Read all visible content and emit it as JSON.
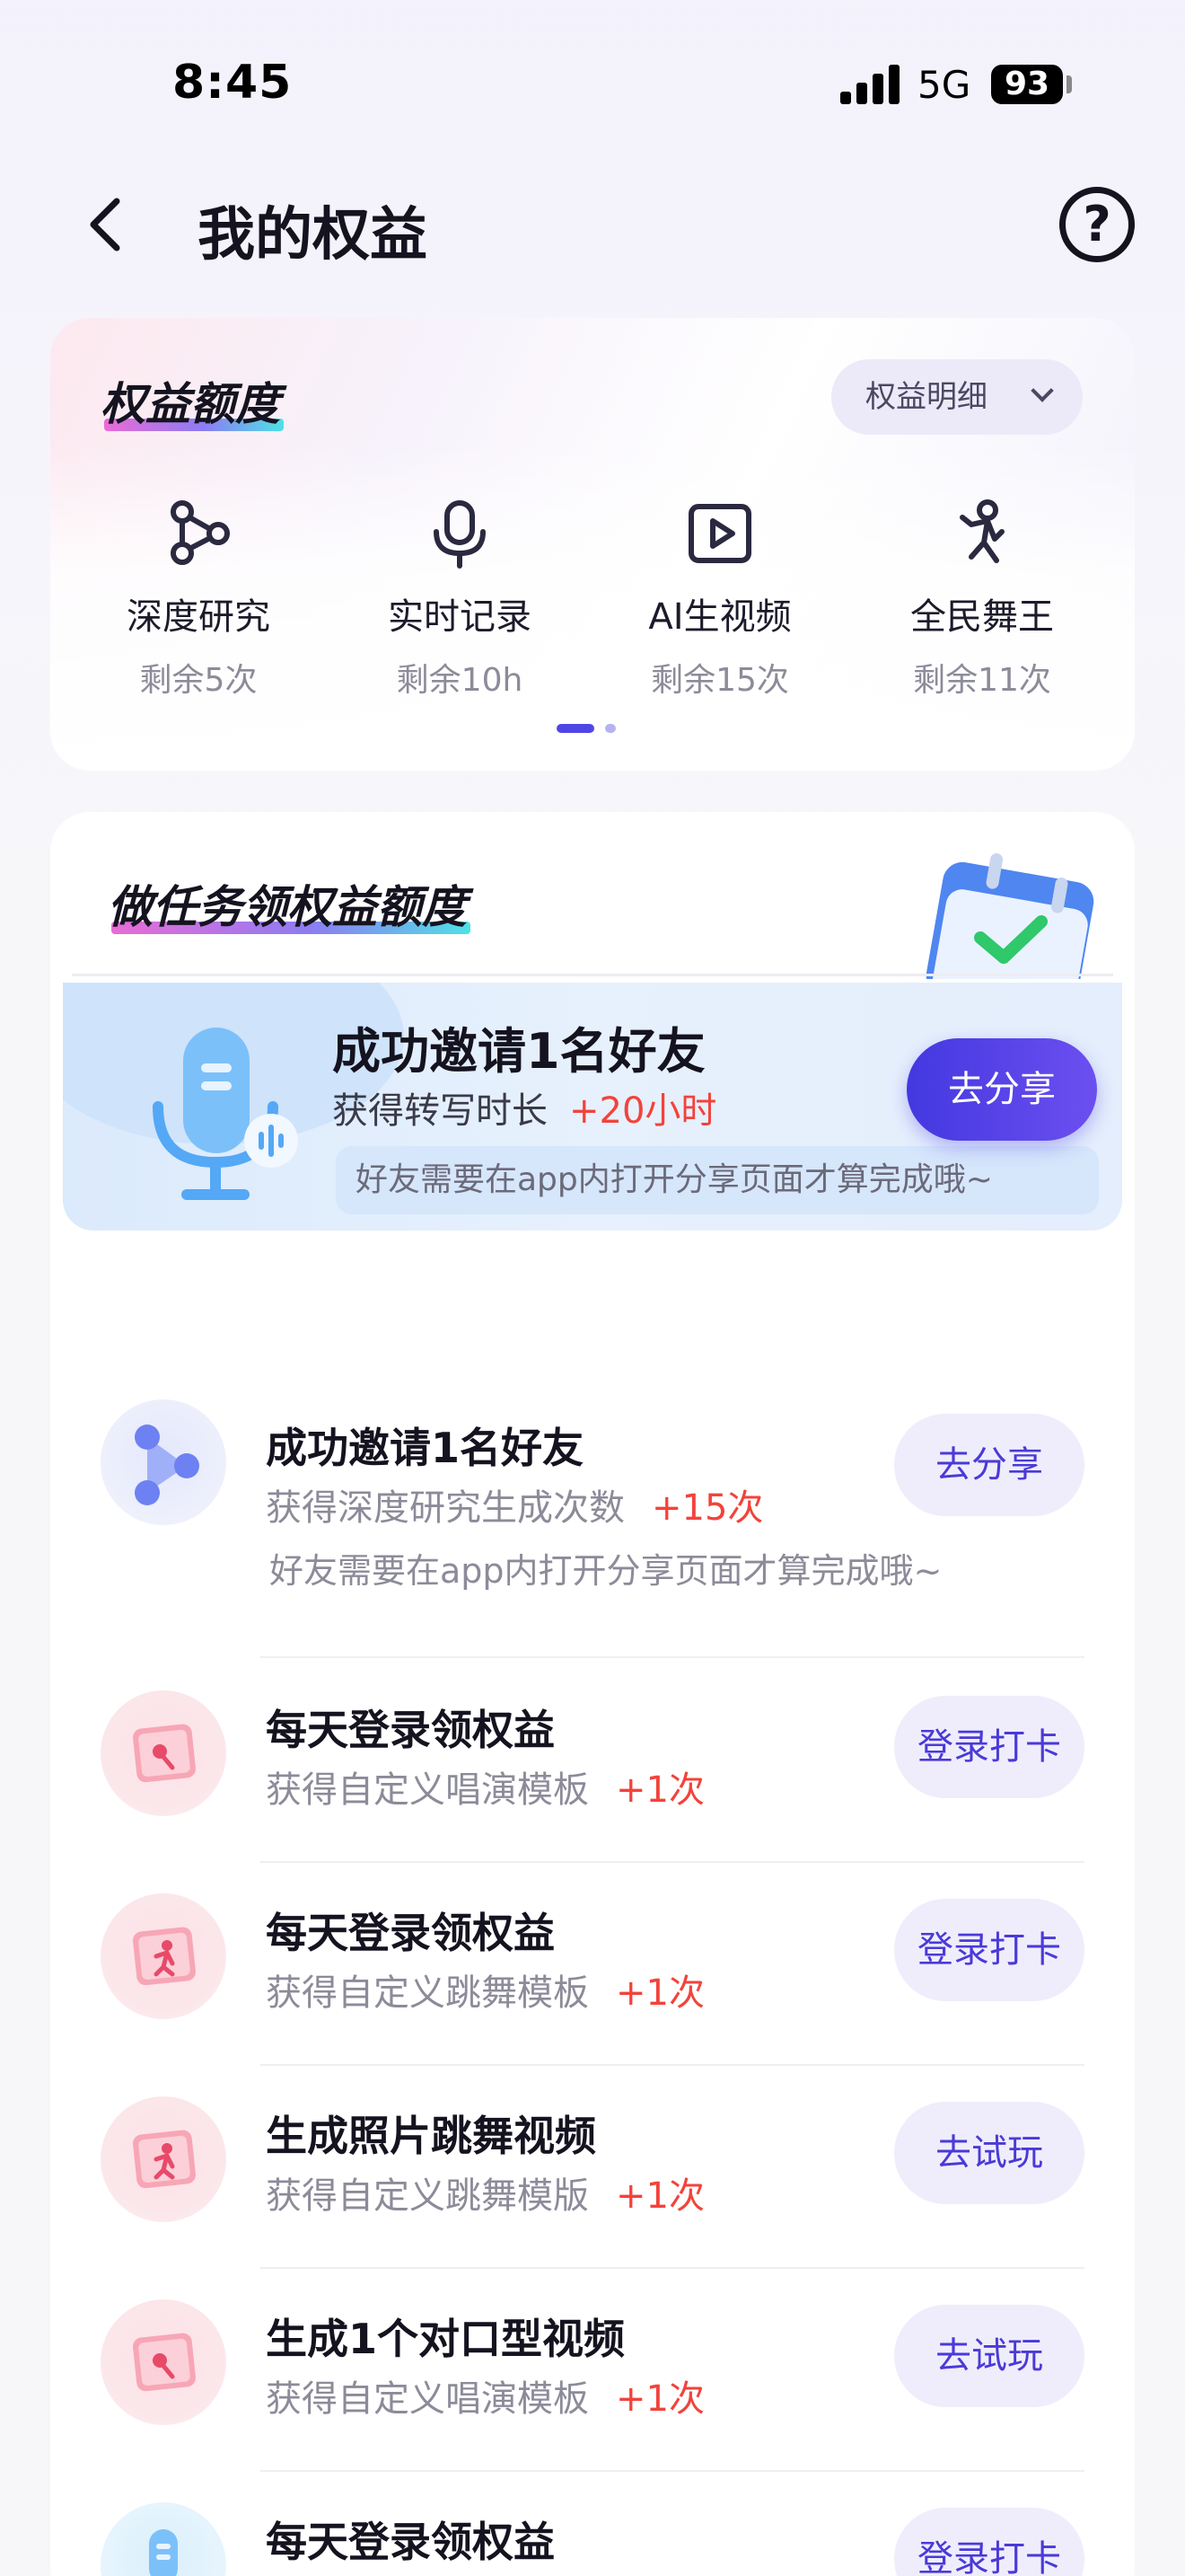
{
  "status_bar": {
    "time": "8:45",
    "network": "5G",
    "battery": "93"
  },
  "header": {
    "title": "我的权益",
    "help": "?"
  },
  "quota": {
    "title": "权益额度",
    "detail_label": "权益明细",
    "items": [
      {
        "name": "深度研究",
        "remaining": "剩余5次",
        "icon": "graph-icon"
      },
      {
        "name": "实时记录",
        "remaining": "剩余10h",
        "icon": "microphone-icon"
      },
      {
        "name": "AI生视频",
        "remaining": "剩余15次",
        "icon": "video-play-icon"
      },
      {
        "name": "全民舞王",
        "remaining": "剩余11次",
        "icon": "dancer-icon"
      }
    ],
    "page_dots": {
      "active": 1,
      "total": 2
    }
  },
  "tasks": {
    "title": "做任务领权益额度",
    "featured": {
      "title": "成功邀请1名好友",
      "reward_label": "获得转写时长",
      "reward_value": "+20小时",
      "note": "好友需要在app内打开分享页面才算完成哦~",
      "button": "去分享"
    },
    "items": [
      {
        "title": "成功邀请1名好友",
        "reward_label": "获得深度研究生成次数",
        "reward_value": "+15次",
        "note": "好友需要在app内打开分享页面才算完成哦~",
        "button": "去分享",
        "icon": "share-graph-icon"
      },
      {
        "title": "每天登录领权益",
        "reward_label": "获得自定义唱演模板",
        "reward_value": "+1次",
        "button": "登录打卡",
        "icon": "singing-template-icon"
      },
      {
        "title": "每天登录领权益",
        "reward_label": "获得自定义跳舞模板",
        "reward_value": "+1次",
        "button": "登录打卡",
        "icon": "dance-template-icon"
      },
      {
        "title": "生成照片跳舞视频",
        "reward_label": "获得自定义跳舞模版",
        "reward_value": "+1次",
        "button": "去试玩",
        "icon": "dance-template-icon"
      },
      {
        "title": "生成1个对口型视频",
        "reward_label": "获得自定义唱演模板",
        "reward_value": "+1次",
        "button": "去试玩",
        "icon": "singing-template-icon"
      },
      {
        "title": "每天登录领权益",
        "reward_label": "",
        "reward_value": "",
        "button": "登录打卡",
        "icon": "microphone-icon"
      }
    ]
  },
  "colors": {
    "accent": "#4338e0",
    "reward": "#f2433b",
    "secondary_button_bg": "#efedfb"
  }
}
